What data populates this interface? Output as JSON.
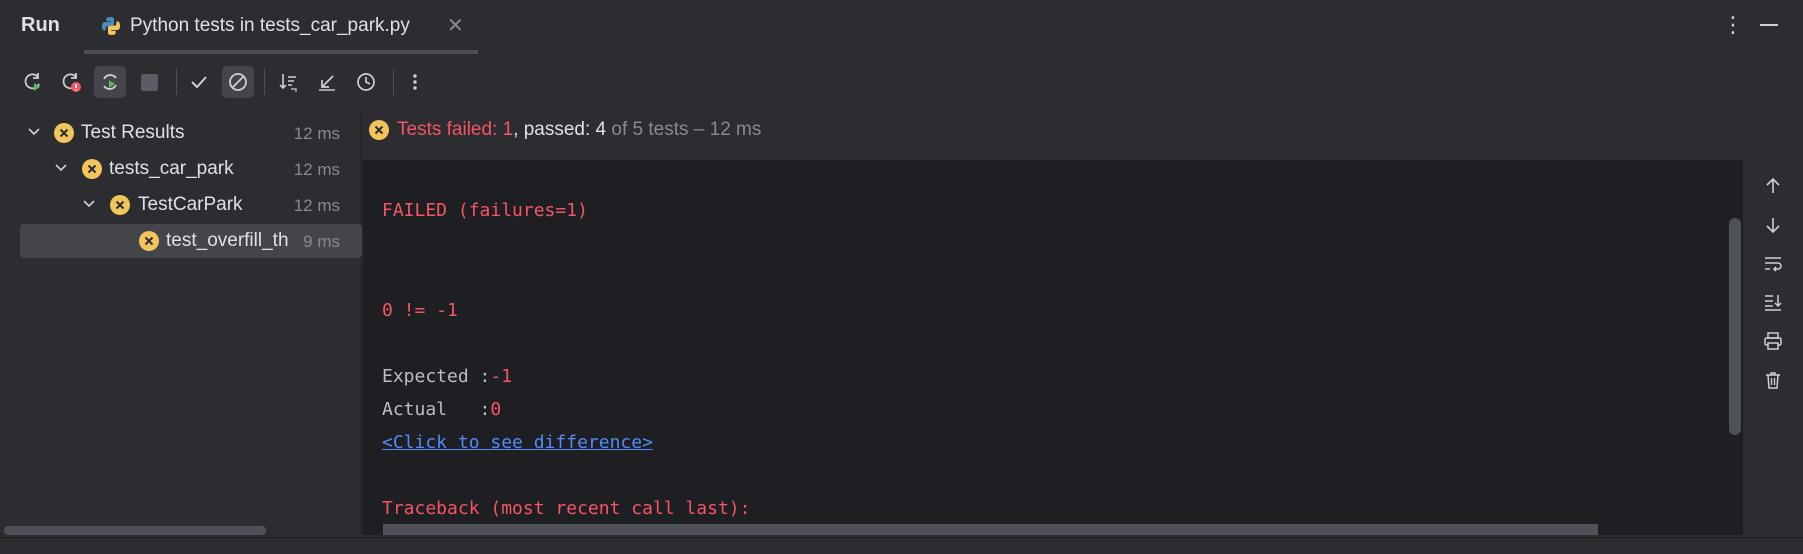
{
  "header": {
    "run_label": "Run",
    "tab_label": "Python tests in tests_car_park.py",
    "close_glyph": "✕",
    "more_glyph": "⋮"
  },
  "toolbar": {
    "buttons": [
      {
        "name": "rerun-icon",
        "active": false
      },
      {
        "name": "rerun-failed-icon",
        "active": false
      },
      {
        "name": "toggle-auto-test-icon",
        "active": true
      },
      {
        "name": "stop-icon",
        "active": false
      },
      {
        "name": "show-passed-icon",
        "active": false
      },
      {
        "name": "show-ignored-icon",
        "active": true
      },
      {
        "name": "sort-icon",
        "active": false
      },
      {
        "name": "collapse-icon",
        "active": false
      },
      {
        "name": "history-icon",
        "active": false
      },
      {
        "name": "more-icon",
        "active": false
      }
    ]
  },
  "tree": {
    "items": [
      {
        "label": "Test Results",
        "time": "12 ms",
        "level": 0,
        "expanded": true,
        "selected": false
      },
      {
        "label": "tests_car_park",
        "time": "12 ms",
        "level": 1,
        "expanded": true,
        "selected": false
      },
      {
        "label": "TestCarPark",
        "time": "12 ms",
        "level": 2,
        "expanded": true,
        "selected": false
      },
      {
        "label": "test_overfill_th",
        "time": "9 ms",
        "level": 3,
        "expanded": false,
        "selected": true
      }
    ]
  },
  "status": {
    "failed": "Tests failed: 1",
    "sep": ", ",
    "passed": "passed: 4",
    "total": " of 5 tests – 12 ms"
  },
  "console": {
    "failed_line": "FAILED (failures=1)",
    "assert_line": "0 != -1",
    "expected_label": "Expected :",
    "expected_value": "-1",
    "actual_label": "Actual   :",
    "actual_value": "0",
    "diff_link": "<Click to see difference>",
    "traceback_line": "Traceback (most recent call last):"
  },
  "rail": {
    "buttons": [
      "up-arrow-icon",
      "down-arrow-icon",
      "soft-wrap-icon",
      "scroll-to-end-icon",
      "print-icon",
      "trash-icon"
    ]
  },
  "colors": {
    "background": "#2b2d30",
    "console_bg": "#1e1f22",
    "error_red": "#f75464",
    "link_blue": "#548af7",
    "badge_yellow": "#f2c55c"
  }
}
